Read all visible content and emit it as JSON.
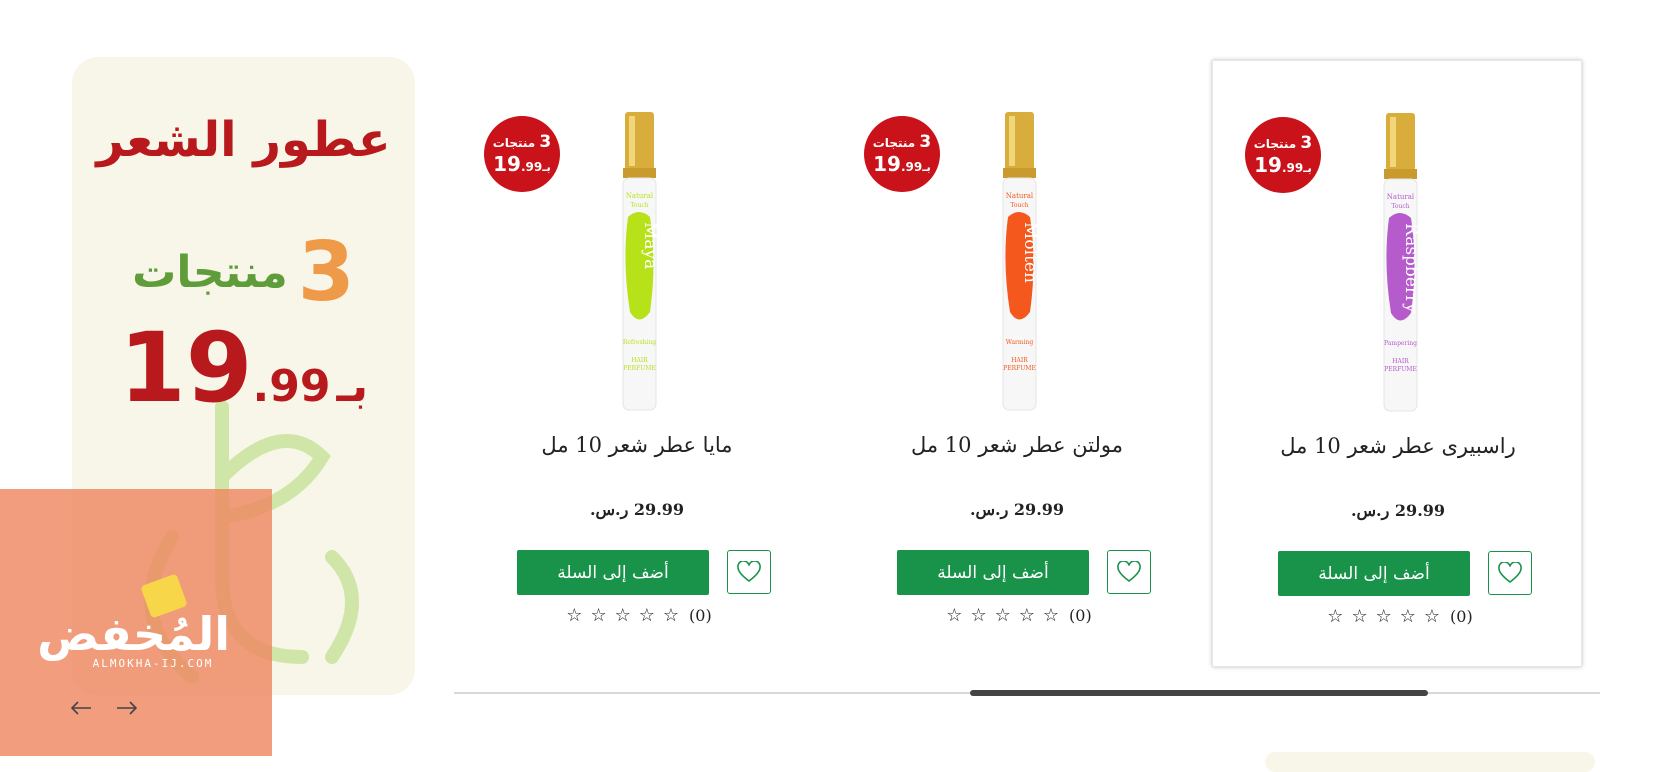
{
  "promo": {
    "title": "عطور الشعر",
    "count_number": "3",
    "count_label": "منتجات",
    "price_main": "19",
    "price_decimals": ".99",
    "price_prefix": "بـ"
  },
  "watermark": {
    "logo_text": "المُخفض",
    "sub_text": "ALMOKHA-IJ.COM"
  },
  "badge": {
    "count": "3",
    "label": "منتجات",
    "price": "19",
    "decimals": ".99",
    "prefix": "بـ"
  },
  "products": [
    {
      "name": "راسبيرى عطر شعر 10 مل",
      "price": "29.99 ر.س.",
      "add_label": "أضف إلى السلة",
      "rating_count": "(0)",
      "bottle": {
        "label": "Raspberry",
        "sub": "Pampering",
        "color": "#b55bcc"
      }
    },
    {
      "name": "مولتن عطر شعر 10 مل",
      "price": "29.99 ر.س.",
      "add_label": "أضف إلى السلة",
      "rating_count": "(0)",
      "bottle": {
        "label": "Molten",
        "sub": "Warming",
        "color": "#f4581c"
      }
    },
    {
      "name": "مايا عطر شعر 10 مل",
      "price": "29.99 ر.س.",
      "add_label": "أضف إلى السلة",
      "rating_count": "(0)",
      "bottle": {
        "label": "Maya",
        "sub": "Refreshing",
        "color": "#b7e21a"
      }
    }
  ],
  "stars": [
    "☆",
    "☆",
    "☆",
    "☆",
    "☆"
  ],
  "colors": {
    "brand_green": "#19934a",
    "badge_red": "#c91219",
    "promo_bg": "#f8f6e8",
    "promo_red": "#b8191c",
    "promo_orange": "#ef9a48",
    "promo_green": "#5f9c3a"
  },
  "icons": {
    "wishlist": "heart-icon",
    "prev": "arrow-left-icon",
    "next": "arrow-right-icon"
  }
}
